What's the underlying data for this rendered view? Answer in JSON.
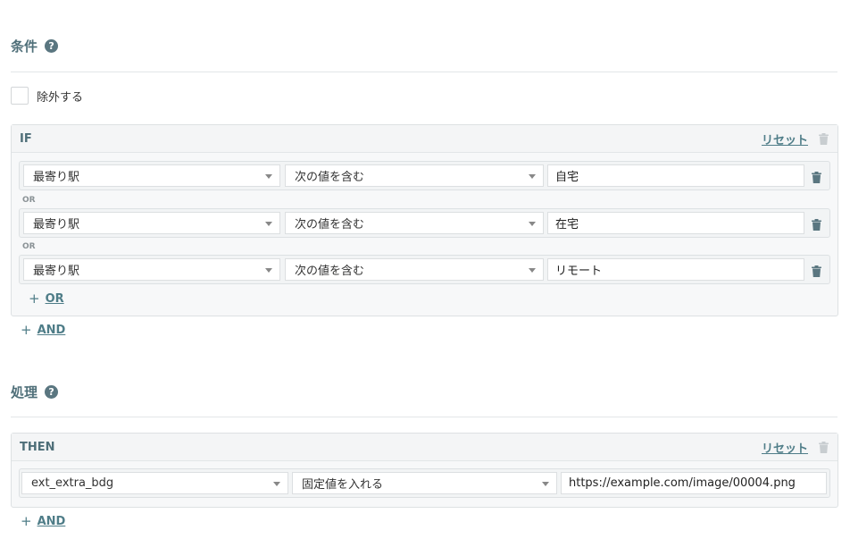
{
  "conditions": {
    "title": "条件",
    "help": "?",
    "exclude_label": "除外する",
    "panel_label": "IF",
    "reset_label": "リセット",
    "rows": [
      {
        "field": "最寄り駅",
        "operator": "次の値を含む",
        "value": "自宅"
      },
      {
        "field": "最寄り駅",
        "operator": "次の値を含む",
        "value": "在宅"
      },
      {
        "field": "最寄り駅",
        "operator": "次の値を含む",
        "value": "リモート"
      }
    ],
    "or_label": "OR",
    "add_or_label": "OR",
    "add_and_label": "AND"
  },
  "actions": {
    "title": "処理",
    "help": "?",
    "panel_label": "THEN",
    "reset_label": "リセット",
    "rows": [
      {
        "field": "ext_extra_bdg",
        "operator": "固定値を入れる",
        "value": "https://example.com/image/00004.png"
      }
    ],
    "add_and_label": "AND"
  },
  "colors": {
    "accent": "#4f7d88",
    "title": "#4f6f79",
    "border": "#dde1e3"
  }
}
